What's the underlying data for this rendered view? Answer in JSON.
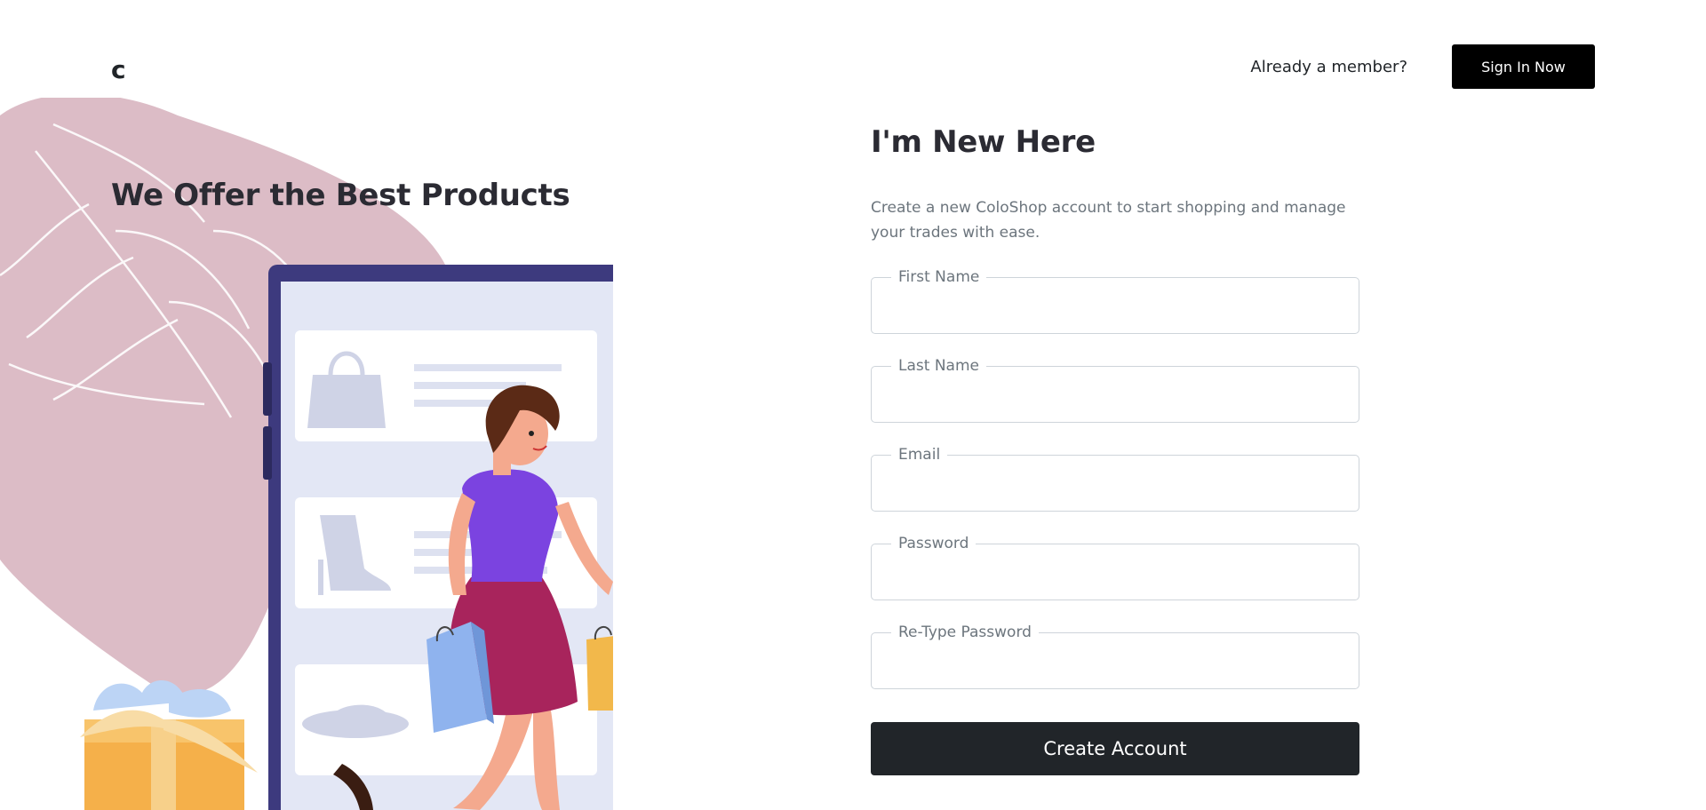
{
  "header": {
    "logo": "c",
    "member_text": "Already a member?",
    "signin_label": "Sign In Now"
  },
  "hero": {
    "title": "We Offer the Best Products"
  },
  "form": {
    "title": "I'm New Here",
    "description": "Create a new ColoShop account to start shopping and manage your trades with ease.",
    "fields": [
      {
        "label": "First Name",
        "value": ""
      },
      {
        "label": "Last Name",
        "value": ""
      },
      {
        "label": "Email",
        "value": ""
      },
      {
        "label": "Password",
        "value": ""
      },
      {
        "label": "Re-Type Password",
        "value": ""
      }
    ],
    "submit_label": "Create Account"
  },
  "colors": {
    "primary_dark": "#212529",
    "black": "#000000",
    "leaf_pink": "#dcbcc6",
    "phone_frame": "#3d3a7e",
    "phone_screen": "#e3e7f5",
    "top_purple": "#7b43e0",
    "skirt_magenta": "#a8245c",
    "bag_blue": "#8fb3ee",
    "bag_yellow": "#f2b84b",
    "gift_orange": "#f5b04a"
  }
}
